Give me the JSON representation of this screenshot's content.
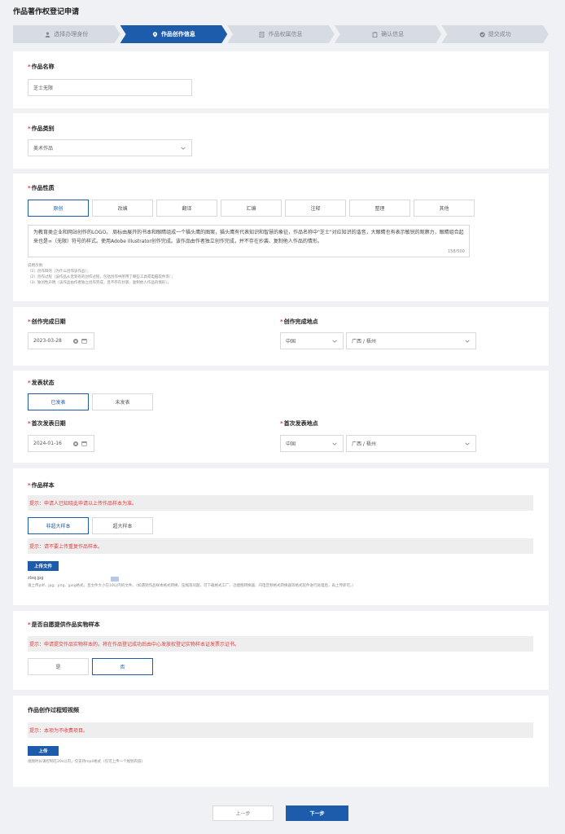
{
  "page_title": "作品著作权登记申请",
  "steps": [
    {
      "label": "选择办理身份",
      "icon": "person-icon"
    },
    {
      "label": "作品创作信息",
      "icon": "location-pin-icon"
    },
    {
      "label": "作品权属信息",
      "icon": "document-icon"
    },
    {
      "label": "确认信息",
      "icon": "clipboard-icon"
    },
    {
      "label": "提交成功",
      "icon": "check-circle-icon"
    }
  ],
  "work_name": {
    "label": "作品名称",
    "value": "芝士无限"
  },
  "work_category": {
    "label": "作品类别",
    "value": "美术作品"
  },
  "work_nature": {
    "label": "作品性质",
    "options": [
      "原创",
      "改编",
      "翻译",
      "汇编",
      "注释",
      "整理",
      "其他"
    ],
    "selected": "原创",
    "description": "为教育类企业和网站创作的LOGO。 周标由展开的书本和眼睛组成一个猫头鹰的图案，猫头鹰有代表知识和智慧的象征，作品名称中\"芝士\"对应知识的谐音，大眼睛也有表示敏锐的观察力，眼睛组合起来也是∞（无限）符号的样式。使用Adobe Illustrator创作完成。该作品由作者独立创作完成，并不存在抄袭、复制他人作品的情形。",
    "char_count": "158/500",
    "help_title": "说明示例:",
    "help_lines": [
      "（1）创作目的（为什么创作该作品）；",
      "（2）创作过程（该作品从无到有的创作过程，包括创作中所用了哪些工具或电脑软件等）；",
      "（3）独创性声明（该作品由作者独立创作完成，且不存在抄袭、复制他人作品的情形）。"
    ]
  },
  "completion_date": {
    "label": "创作完成日期",
    "value": "2023-03-28"
  },
  "completion_place": {
    "label": "创作完成地点",
    "country": "中国",
    "region": "广西 / 梧州"
  },
  "publish_status": {
    "label": "发表状态",
    "options": [
      "已发表",
      "未发表"
    ],
    "selected": "已发表"
  },
  "first_publish_date": {
    "label": "首次发表日期",
    "value": "2024-01-16"
  },
  "first_publish_place": {
    "label": "首次发表地点",
    "country": "中国",
    "region": "广西 / 梧州"
  },
  "sample": {
    "label": "作品样本",
    "tip1": "提示：申请人已知晓此申请以上传作品样本为准。",
    "options": [
      "非超大样本",
      "超大样本"
    ],
    "selected": "非超大样本",
    "tip2": "提示：请不要上传重复作品样本。",
    "upload_label": "上传文件",
    "file_name": "zlxq.jpg",
    "hint": "请上传pdf、jpg、png、jpeg格式，且文件大小在10以内的文件。（如遇到作品样本格式转换、压缩等问题，可下载格式工厂、迅捷图转换器、闪电音频格式转换器等格式软件进行处理后，再上传即可。）"
  },
  "physical_sample": {
    "label": "是否自愿提供作品实物样本",
    "tip": "提示：申请提交作品实物样本的，将在作品登记成功后由中心发放权登记实物样本证发票示证书。",
    "options": [
      "是",
      "否"
    ],
    "selected": "否"
  },
  "video": {
    "label": "作品创作过程短视频",
    "tip": "提示：本项为不收费项目。",
    "upload_label": "上传",
    "hint": "视频时长请控制在20s以内，仅支持mp4格式（仅可上传一个视频内容）"
  },
  "nav": {
    "prev": "上一步",
    "next": "下一步"
  },
  "colors": {
    "primary": "#1d5cab",
    "required": "#e4393c",
    "tip_text": "#e4393c"
  }
}
